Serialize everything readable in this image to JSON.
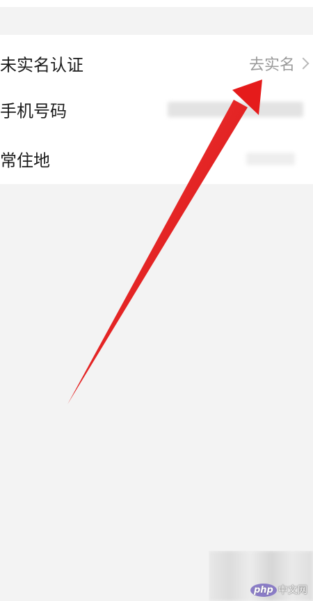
{
  "profile_rows": [
    {
      "label": "未实名认证",
      "action": "去实名"
    },
    {
      "label": "手机号码"
    },
    {
      "label": "常住地"
    }
  ],
  "icons": {
    "chevron": "chevron-right-icon",
    "arrow": "arrow-annotation-icon"
  },
  "colors": {
    "page_background": "#f3f3f3",
    "card_background": "#ffffff",
    "label_text": "#1b1b1b",
    "action_text": "#9a9a9a",
    "arrow": "#e51b1b"
  },
  "watermark": {
    "logo_text": "php",
    "site_text": "中文网"
  }
}
